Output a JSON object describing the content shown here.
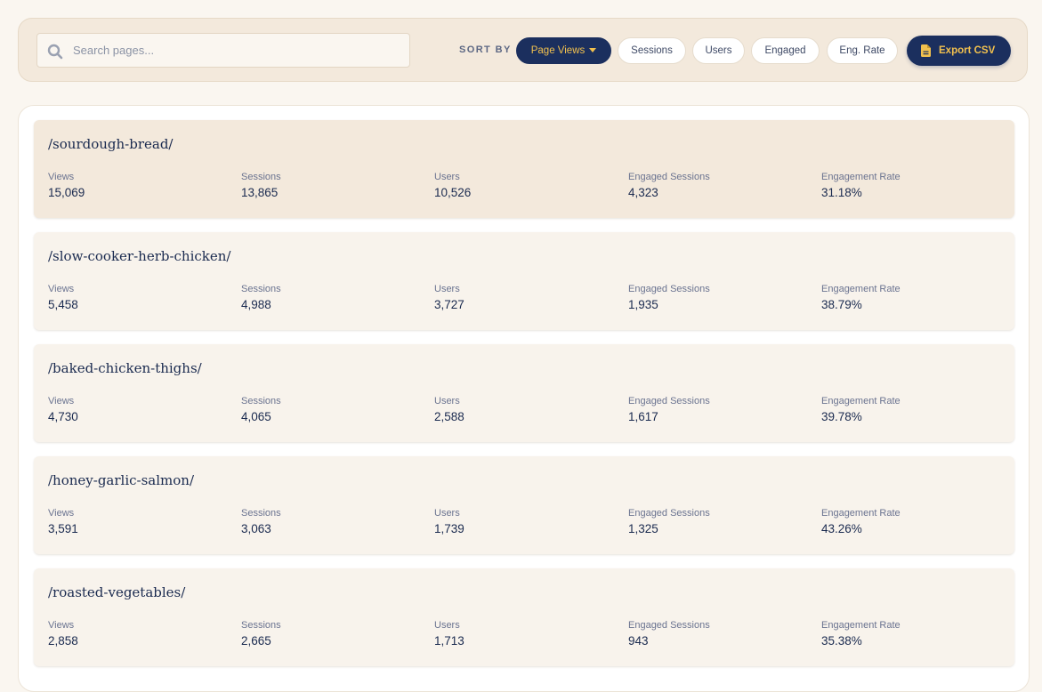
{
  "search": {
    "placeholder": "Search pages..."
  },
  "sort": {
    "label": "SORT BY",
    "options": [
      {
        "label": "Page Views",
        "active": true
      },
      {
        "label": "Sessions",
        "active": false
      },
      {
        "label": "Users",
        "active": false
      },
      {
        "label": "Engaged",
        "active": false
      },
      {
        "label": "Eng. Rate",
        "active": false
      }
    ]
  },
  "export": {
    "label": "Export CSV",
    "icon": "file-csv-icon"
  },
  "metric_labels": [
    "Views",
    "Sessions",
    "Users",
    "Engaged Sessions",
    "Engagement Rate"
  ],
  "pages": [
    {
      "path": "/sourdough-bread/",
      "views": "15,069",
      "sessions": "13,865",
      "users": "10,526",
      "engaged": "4,323",
      "rate": "31.18%"
    },
    {
      "path": "/slow-cooker-herb-chicken/",
      "views": "5,458",
      "sessions": "4,988",
      "users": "3,727",
      "engaged": "1,935",
      "rate": "38.79%"
    },
    {
      "path": "/baked-chicken-thighs/",
      "views": "4,730",
      "sessions": "4,065",
      "users": "2,588",
      "engaged": "1,617",
      "rate": "39.78%"
    },
    {
      "path": "/honey-garlic-salmon/",
      "views": "3,591",
      "sessions": "3,063",
      "users": "1,739",
      "engaged": "1,325",
      "rate": "43.26%"
    },
    {
      "path": "/roasted-vegetables/",
      "views": "2,858",
      "sessions": "2,665",
      "users": "1,713",
      "engaged": "943",
      "rate": "35.38%"
    }
  ],
  "colors": {
    "accent": "#1b2f5e",
    "accent_text": "#f2c14e",
    "highlight_row": "#f3e9dc",
    "row": "#f8f3ec",
    "background": "#faf6f0"
  }
}
